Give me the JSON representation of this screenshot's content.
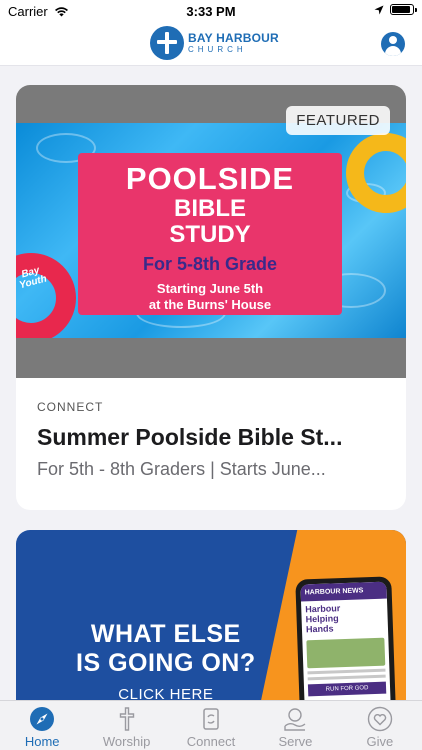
{
  "status_bar": {
    "carrier": "Carrier",
    "time": "3:33 PM",
    "battery_level": 0.9
  },
  "header": {
    "logo_name": "BAY HARBOUR",
    "logo_sub": "CHURCH"
  },
  "featured_card": {
    "badge": "FEATURED",
    "image": {
      "line1": "POOLSIDE",
      "line2": "BIBLE",
      "line3": "STUDY",
      "grade": "For 5-8th Grade",
      "date_line1": "Starting June 5th",
      "date_line2": "at the Burns' House",
      "float_label_1": "Bay",
      "float_label_2": "Youth"
    },
    "category": "CONNECT",
    "title": "Summer Poolside Bible St...",
    "subtitle": "For 5th - 8th Graders | Starts June..."
  },
  "second_card": {
    "headline_1": "WHAT ELSE",
    "headline_2": "IS GOING ON?",
    "cta": "CLICK HERE",
    "phone": {
      "news_title": "HARBOUR NEWS",
      "news_headline_1": "Harbour",
      "news_headline_2": "Helping",
      "news_headline_3": "Hands",
      "button": "RUN FOR GOD"
    }
  },
  "tabs": [
    {
      "label": "Home",
      "icon": "compass-icon",
      "active": true
    },
    {
      "label": "Worship",
      "icon": "cross-icon",
      "active": false
    },
    {
      "label": "Connect",
      "icon": "connect-icon",
      "active": false
    },
    {
      "label": "Serve",
      "icon": "serve-icon",
      "active": false
    },
    {
      "label": "Give",
      "icon": "heart-icon",
      "active": false
    }
  ],
  "colors": {
    "brand": "#1f6db5",
    "promo_pink": "#e9356b",
    "promo_blue": "#1e4fa0",
    "promo_orange": "#f7941e"
  }
}
